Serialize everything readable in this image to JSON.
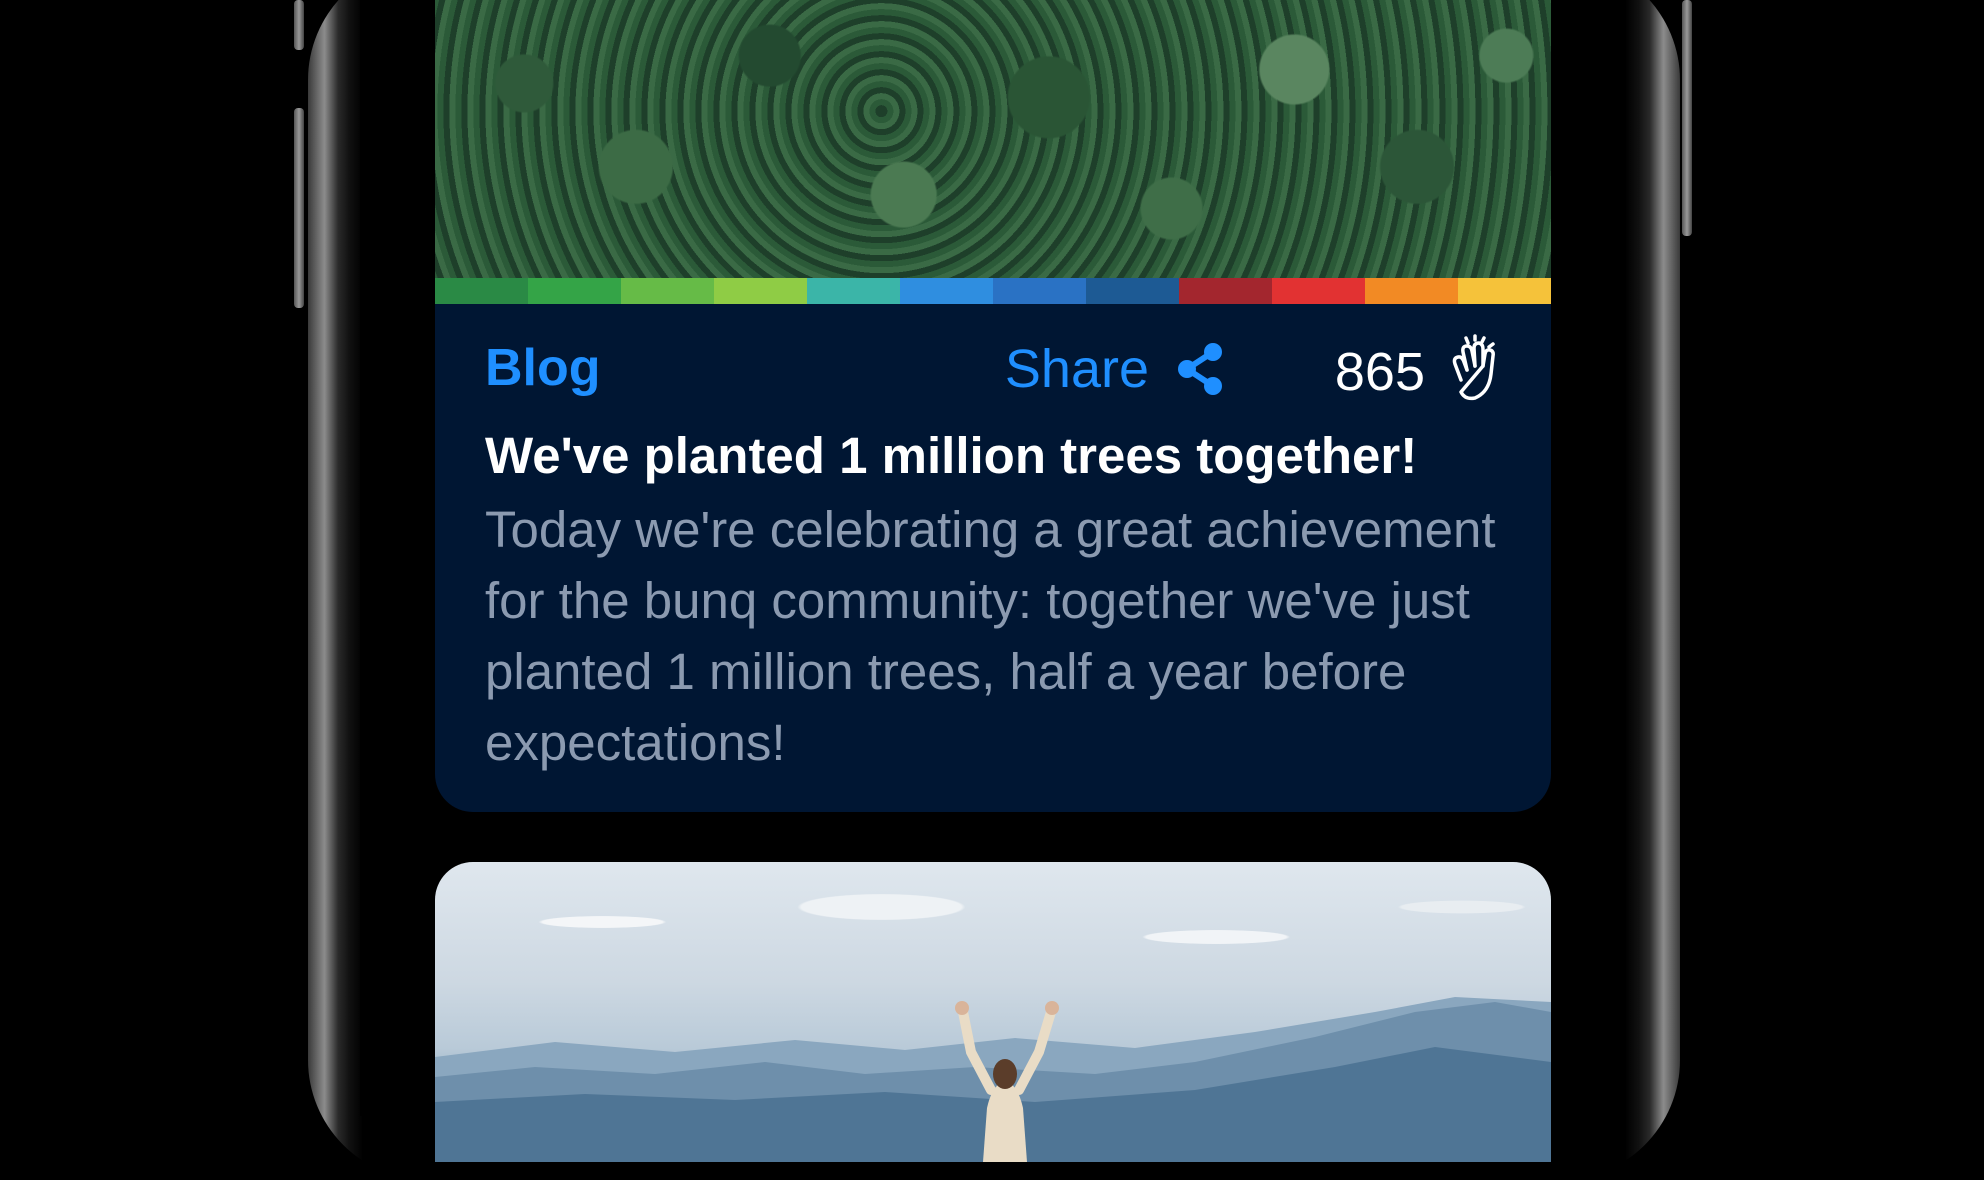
{
  "article_card": {
    "category": "Blog",
    "share_label": "Share",
    "clap_count": "865",
    "title": "We've planted 1 million trees together!",
    "excerpt": "Today we're celebrating a great achievement for the bunq community: together we've just planted 1 million trees, half a year before expectations!",
    "image": "aerial-forest-image",
    "stripe_colors": [
      "#2a8a45",
      "#34a447",
      "#66bb47",
      "#8fcc45",
      "#3bb5a8",
      "#2f8ee0",
      "#2a72c4",
      "#1d5a94",
      "#a3262e",
      "#e23232",
      "#f28a24",
      "#f5c23a"
    ]
  },
  "next_card": {
    "image": "person-on-mountain-image"
  },
  "colors": {
    "accent": "#1f8fff",
    "card_background": "#001633",
    "title": "#ffffff",
    "excerpt": "#8b9ab0"
  },
  "icons": {
    "share": "share-icon",
    "clap": "clap-hands-icon"
  }
}
